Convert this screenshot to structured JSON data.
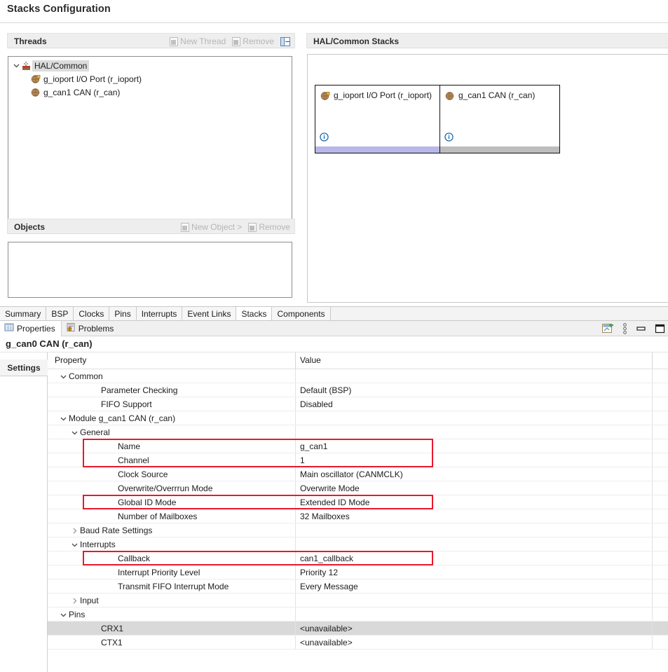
{
  "page": {
    "title": "Stacks Configuration"
  },
  "threads_panel": {
    "title": "Threads",
    "actions": [
      {
        "label": "New Thread",
        "icon": "new-thread-icon",
        "disabled": true
      },
      {
        "label": "Remove",
        "icon": "remove-icon",
        "disabled": true
      }
    ],
    "collapse_icon": "collapse-all-icon",
    "tree": [
      {
        "label": "HAL/Common",
        "icon": "hal-common-icon",
        "level": 0,
        "expanded": true,
        "selected": true
      },
      {
        "label": "g_ioport I/O Port (r_ioport)",
        "icon": "module-icon",
        "level": 1,
        "selected": false
      },
      {
        "label": "g_can1 CAN (r_can)",
        "icon": "module-icon",
        "level": 1,
        "selected": false
      }
    ]
  },
  "objects_panel": {
    "title": "Objects",
    "actions": [
      {
        "label": "New Object >",
        "icon": "new-object-icon",
        "disabled": true
      },
      {
        "label": "Remove",
        "icon": "remove-icon",
        "disabled": true
      }
    ],
    "items": []
  },
  "stacks_panel": {
    "title": "HAL/Common Stacks",
    "cards": [
      {
        "label": "g_ioport I/O Port (r_ioport)",
        "icon": "module-icon",
        "info_icon": "info-icon",
        "footer_color": "#b8b8e8"
      },
      {
        "label": "g_can1 CAN (r_can)",
        "icon": "module-icon",
        "info_icon": "info-icon",
        "footer_color": "#bdbdbd"
      }
    ]
  },
  "editor_tabs": {
    "items": [
      "Summary",
      "BSP",
      "Clocks",
      "Pins",
      "Interrupts",
      "Event Links",
      "Stacks",
      "Components"
    ],
    "active": "Stacks"
  },
  "view_tabs": {
    "items": [
      {
        "label": "Properties",
        "icon": "properties-icon",
        "active": true
      },
      {
        "label": "Problems",
        "icon": "problems-icon",
        "active": false
      }
    ],
    "toolbar": [
      {
        "name": "new-view-icon"
      },
      {
        "name": "view-menu-icon"
      },
      {
        "name": "minimize-icon"
      },
      {
        "name": "maximize-icon"
      }
    ]
  },
  "properties": {
    "title": "g_can0 CAN (r_can)",
    "side_tab": "Settings",
    "columns": {
      "property": "Property",
      "value": "Value"
    },
    "rows": [
      {
        "name": "Common",
        "value": "",
        "indent": 0,
        "twisty": "down"
      },
      {
        "name": "Parameter Checking",
        "value": "Default (BSP)",
        "indent": 1,
        "twisty": ""
      },
      {
        "name": "FIFO Support",
        "value": "Disabled",
        "indent": 1,
        "twisty": ""
      },
      {
        "name": "Module g_can1 CAN (r_can)",
        "value": "",
        "indent": 0,
        "twisty": "down"
      },
      {
        "name": "General",
        "value": "",
        "indent": 1,
        "twisty": "down"
      },
      {
        "name": "Name",
        "value": "g_can1",
        "indent": 2,
        "twisty": ""
      },
      {
        "name": "Channel",
        "value": "1",
        "indent": 2,
        "twisty": ""
      },
      {
        "name": "Clock Source",
        "value": "Main oscillator (CANMCLK)",
        "indent": 2,
        "twisty": ""
      },
      {
        "name": "Overwrite/Overrrun Mode",
        "value": "Overwrite Mode",
        "indent": 2,
        "twisty": ""
      },
      {
        "name": "Global ID Mode",
        "value": "Extended ID Mode",
        "indent": 2,
        "twisty": ""
      },
      {
        "name": "Number of Mailboxes",
        "value": "32 Mailboxes",
        "indent": 2,
        "twisty": ""
      },
      {
        "name": "Baud Rate Settings",
        "value": "",
        "indent": 1,
        "twisty": "right"
      },
      {
        "name": "Interrupts",
        "value": "",
        "indent": 1,
        "twisty": "down"
      },
      {
        "name": "Callback",
        "value": "can1_callback",
        "indent": 2,
        "twisty": ""
      },
      {
        "name": "Interrupt Priority Level",
        "value": "Priority 12",
        "indent": 2,
        "twisty": ""
      },
      {
        "name": "Transmit FIFO Interrupt Mode",
        "value": "Every Message",
        "indent": 2,
        "twisty": ""
      },
      {
        "name": "Input",
        "value": "",
        "indent": 1,
        "twisty": "right"
      },
      {
        "name": "Pins",
        "value": "",
        "indent": 0,
        "twisty": "down"
      },
      {
        "name": "CRX1",
        "value": "<unavailable>",
        "indent": 1,
        "twisty": "",
        "shaded": true
      },
      {
        "name": "CTX1",
        "value": "<unavailable>",
        "indent": 1,
        "twisty": ""
      }
    ],
    "highlights": [
      {
        "label": "name-channel-highlight",
        "rows": [
          5,
          6
        ]
      },
      {
        "label": "global-id-mode-highlight",
        "rows": [
          9
        ]
      },
      {
        "label": "callback-highlight",
        "rows": [
          13
        ]
      }
    ],
    "highlight_color": "#e8192c"
  }
}
